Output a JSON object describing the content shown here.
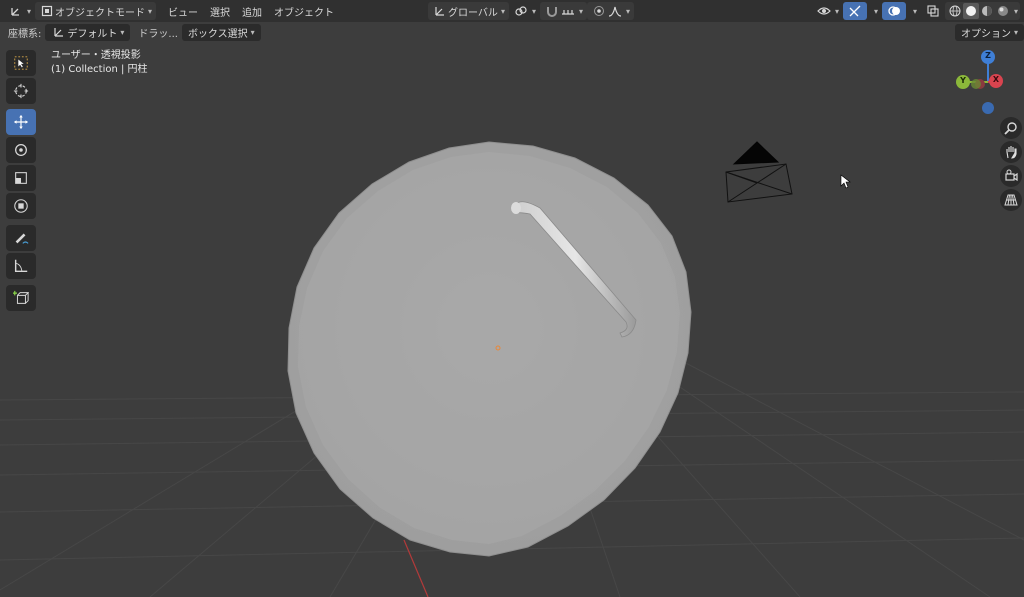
{
  "header": {
    "editor_type_icon": "axes-icon",
    "mode_label": "オブジェクトモード",
    "menu": [
      "ビュー",
      "選択",
      "追加",
      "オブジェクト"
    ],
    "transform_orientation": "グローバル",
    "pivot_icon": "link-icon",
    "snap_icon": "magnet-icon",
    "proportional_icon": "falloff-icon",
    "right_icons": [
      "eye-icon",
      "gizmo-icon",
      "overlay-icon",
      "xray-icon",
      "wireframe-shading-icon",
      "solid-shading-icon",
      "material-shading-icon",
      "rendered-shading-icon"
    ]
  },
  "toolrow": {
    "coord_label": "座標系:",
    "coord_value": "デフォルト",
    "drag_label": "ドラッ...",
    "select_mode": "ボックス選択",
    "options_label": "オプション"
  },
  "viewport": {
    "view_name": "ユーザー・透視投影",
    "collection_info": "(1) Collection | 円柱"
  },
  "left_tools": [
    {
      "name": "select-box-tool",
      "active": false
    },
    {
      "name": "cursor-tool",
      "active": false
    },
    {
      "name": "move-tool",
      "active": true
    },
    {
      "name": "rotate-tool",
      "active": false
    },
    {
      "name": "scale-tool",
      "active": false
    },
    {
      "name": "transform-tool",
      "active": false
    },
    {
      "name": "annotate-tool",
      "active": false
    },
    {
      "name": "measure-tool",
      "active": false
    },
    {
      "name": "add-cube-tool",
      "active": false
    }
  ],
  "gizmo": {
    "z_label": "Z",
    "y_label": "Y",
    "x_label": "X"
  },
  "nav_icons": [
    "zoom-icon",
    "hand-pan-icon",
    "camera-view-icon",
    "grid-perspective-icon"
  ],
  "colors": {
    "accent": "#4772b3",
    "x_axis": "#d9444f",
    "y_axis": "#8bb83a",
    "z_axis": "#3f7fd6",
    "mesh": "#a6a6a6"
  }
}
